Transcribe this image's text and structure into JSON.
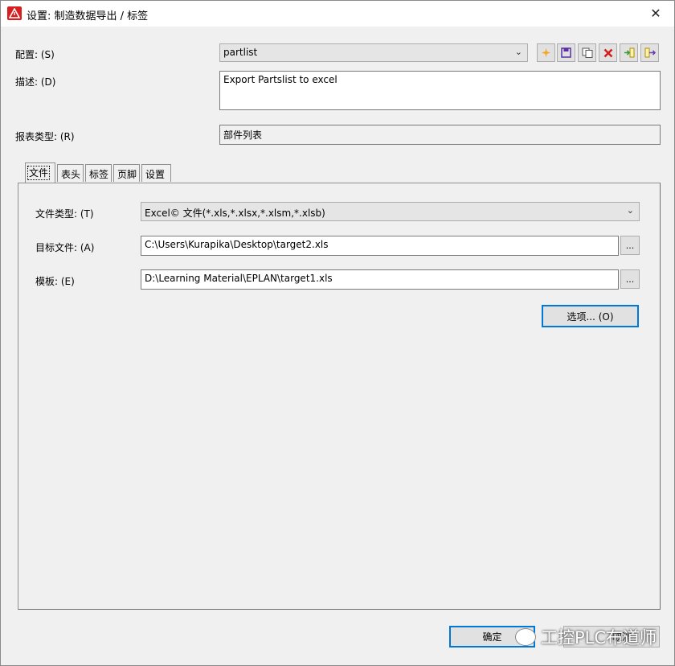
{
  "window": {
    "title": "设置: 制造数据导出 / 标签"
  },
  "config": {
    "label": "配置: (S)",
    "value": "partlist"
  },
  "description": {
    "label": "描述: (D)",
    "value": "Export Partslist to excel"
  },
  "report_type": {
    "label": "报表类型: (R)",
    "value": "部件列表"
  },
  "toolbar": {
    "icons": [
      "new-icon",
      "save-icon",
      "copy-icon",
      "delete-icon",
      "import-icon",
      "export-icon"
    ],
    "colors": {
      "new": "#f5a623",
      "save": "#5a2ea6",
      "delete": "#d21f1f",
      "import": "#2f9e3a",
      "export": "#6a3fb5"
    }
  },
  "tabs": [
    {
      "label": "文件",
      "active": true
    },
    {
      "label": "表头",
      "active": false
    },
    {
      "label": "标签",
      "active": false
    },
    {
      "label": "页脚",
      "active": false
    },
    {
      "label": "设置",
      "active": false
    }
  ],
  "file_tab": {
    "file_type": {
      "label": "文件类型: (T)",
      "value": "Excel© 文件(*.xls,*.xlsx,*.xlsm,*.xlsb)"
    },
    "target_file": {
      "label": "目标文件: (A)",
      "value": "C:\\Users\\Kurapika\\Desktop\\target2.xls"
    },
    "template": {
      "label": "模板: (E)",
      "value": "D:\\Learning Material\\EPLAN\\target1.xls"
    },
    "browse_label": "...",
    "options_button": "选项... (O)"
  },
  "footer": {
    "ok_label": "确定",
    "cancel_label": "取消",
    "watermark": "工控PLC布道师"
  },
  "accent_color": "#0078d7"
}
